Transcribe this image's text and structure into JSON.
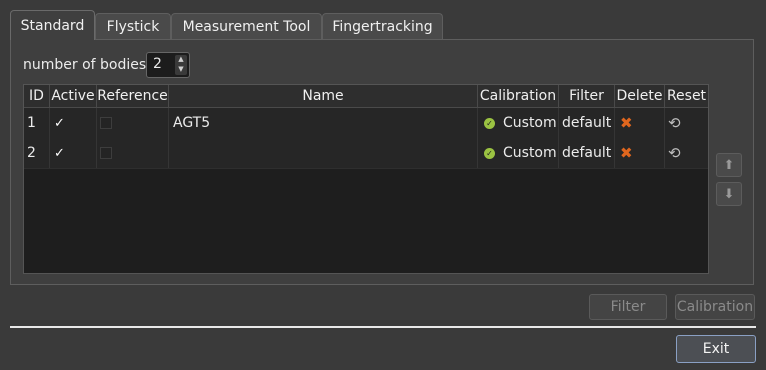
{
  "tabs": [
    {
      "label": "Standard",
      "active": true
    },
    {
      "label": "Flystick",
      "active": false
    },
    {
      "label": "Measurement Tool",
      "active": false
    },
    {
      "label": "Fingertracking",
      "active": false
    }
  ],
  "number_of_bodies": {
    "label": "number of bodies",
    "value": "2"
  },
  "table": {
    "headers": [
      "ID",
      "Active",
      "Reference",
      "Name",
      "Calibration",
      "Filter",
      "Delete",
      "Reset"
    ],
    "rows": [
      {
        "id": "1",
        "active": "✓",
        "name": "AGT5",
        "calibration": "Custom",
        "filter": "default"
      },
      {
        "id": "2",
        "active": "✓",
        "name": "",
        "calibration": "Custom",
        "filter": "default"
      }
    ]
  },
  "icons": {
    "calibration_ok": "check-circle-icon",
    "delete": "x-icon",
    "reset": "reset-icon",
    "move_up": "arrow-up-icon",
    "move_down": "arrow-down-icon"
  },
  "buttons": {
    "filter": "Filter",
    "calibration": "Calibration",
    "exit": "Exit"
  },
  "colors": {
    "calibration_ok": "#9bc342",
    "delete": "#e0661e",
    "exit_border": "#8aa0c4"
  }
}
